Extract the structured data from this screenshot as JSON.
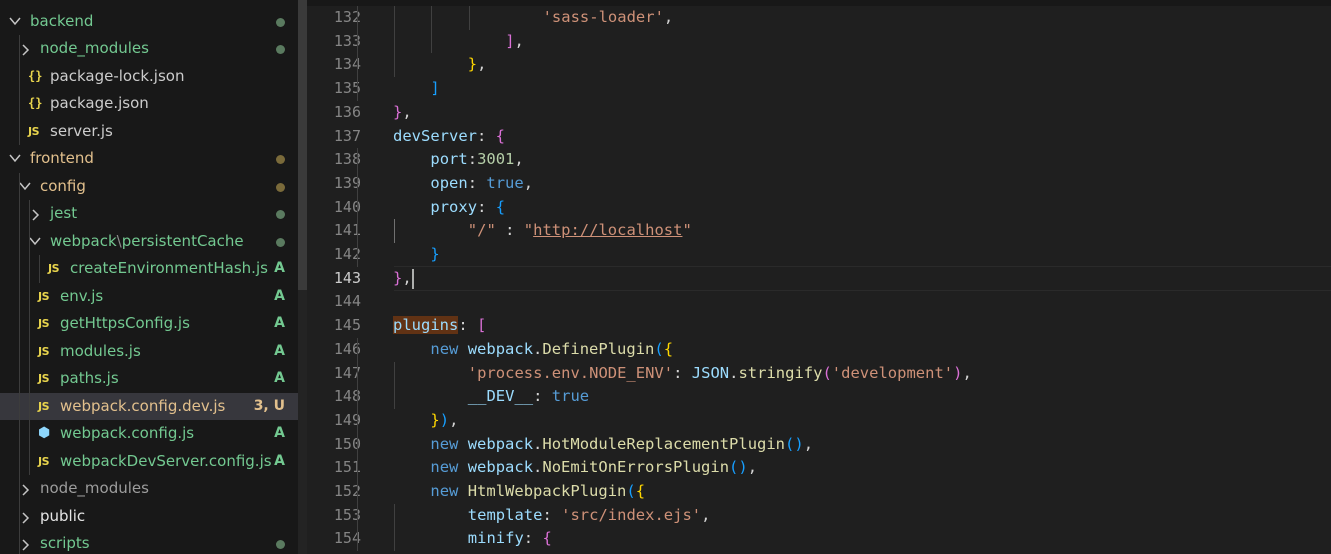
{
  "colors": {
    "folder_modified": "#d7ba7d",
    "folder_clean": "#e5e5e5",
    "added": "#73c991",
    "modified": "#e2c08d",
    "dot_green": "#5a7a5f",
    "dot_yellow": "#7a6a3a",
    "keyword": "#569cd6",
    "string": "#ce9178",
    "property": "#9cdcfe",
    "function": "#dcdcaa",
    "number": "#b5cea8",
    "bracket_gold": "#ffd700",
    "bracket_purple": "#da70d6",
    "bracket_blue": "#179fff"
  },
  "explorer": {
    "items": [
      {
        "label": "backend",
        "type": "folder",
        "expanded": true,
        "depth": 0,
        "decoration": "dot",
        "dot_color": "green",
        "label_color": "added"
      },
      {
        "label": "node_modules",
        "type": "folder",
        "expanded": false,
        "depth": 1,
        "decoration": "dot",
        "dot_color": "green",
        "label_color": "added"
      },
      {
        "label": "package-lock.json",
        "type": "json",
        "depth": 1,
        "label_color": "plain"
      },
      {
        "label": "package.json",
        "type": "json",
        "depth": 1,
        "label_color": "plain"
      },
      {
        "label": "server.js",
        "type": "js",
        "depth": 1,
        "label_color": "plain"
      },
      {
        "label": "frontend",
        "type": "folder",
        "expanded": true,
        "depth": 0,
        "decoration": "dot",
        "dot_color": "yellow",
        "label_color": "modified"
      },
      {
        "label": "config",
        "type": "folder",
        "expanded": true,
        "depth": 1,
        "decoration": "dot",
        "dot_color": "yellow",
        "label_color": "modified"
      },
      {
        "label": "jest",
        "type": "folder",
        "expanded": false,
        "depth": 2,
        "decoration": "dot",
        "dot_color": "green",
        "label_color": "added"
      },
      {
        "label": "webpack",
        "sep": "\\",
        "label2": "persistentCache",
        "type": "folder",
        "expanded": true,
        "depth": 2,
        "decoration": "dot",
        "dot_color": "green",
        "label_color": "added"
      },
      {
        "label": "createEnvironmentHash.js",
        "type": "js",
        "depth": 3,
        "status": "A",
        "label_color": "added"
      },
      {
        "label": "env.js",
        "type": "js",
        "depth": 2,
        "status": "A",
        "label_color": "added"
      },
      {
        "label": "getHttpsConfig.js",
        "type": "js",
        "depth": 2,
        "status": "A",
        "label_color": "added"
      },
      {
        "label": "modules.js",
        "type": "js",
        "depth": 2,
        "status": "A",
        "label_color": "added"
      },
      {
        "label": "paths.js",
        "type": "js",
        "depth": 2,
        "status": "A",
        "label_color": "added"
      },
      {
        "label": "webpack.config.dev.js",
        "type": "js",
        "depth": 2,
        "status": "3, U",
        "label_color": "modified",
        "selected": true
      },
      {
        "label": "webpack.config.js",
        "type": "webpack",
        "depth": 2,
        "status": "A",
        "label_color": "added"
      },
      {
        "label": "webpackDevServer.config.js",
        "type": "js",
        "depth": 2,
        "status": "A",
        "label_color": "added"
      },
      {
        "label": "node_modules",
        "type": "folder",
        "expanded": false,
        "depth": 1,
        "label_color": "dim"
      },
      {
        "label": "public",
        "type": "folder",
        "expanded": false,
        "depth": 1,
        "label_color": "clean"
      },
      {
        "label": "scripts",
        "type": "folder",
        "expanded": false,
        "depth": 1,
        "decoration": "dot",
        "dot_color": "green",
        "label_color": "added"
      }
    ]
  },
  "editor": {
    "active_line": 143,
    "find_widget": {
      "value": "plugins"
    },
    "lines": [
      {
        "n": 132,
        "indent": 5,
        "tokens": [
          [
            "'sass-loader'",
            "string"
          ],
          [
            ",",
            "plain"
          ]
        ]
      },
      {
        "n": 133,
        "indent": 4,
        "tokens": [
          [
            "]",
            "bracket_purple"
          ],
          [
            ",",
            "plain"
          ]
        ]
      },
      {
        "n": 134,
        "indent": 3,
        "tokens": [
          [
            "}",
            "bracket_gold"
          ],
          [
            ",",
            "plain"
          ]
        ]
      },
      {
        "n": 135,
        "indent": 2,
        "tokens": [
          [
            "]",
            "bracket_blue"
          ]
        ]
      },
      {
        "n": 136,
        "indent": 1,
        "tokens": [
          [
            "}",
            "bracket_purple"
          ],
          [
            ",",
            "plain"
          ]
        ]
      },
      {
        "n": 137,
        "indent": 1,
        "tokens": [
          [
            "devServer",
            "property"
          ],
          [
            ": ",
            "plain"
          ],
          [
            "{",
            "bracket_purple"
          ]
        ]
      },
      {
        "n": 138,
        "indent": 2,
        "tokens": [
          [
            "port",
            "property"
          ],
          [
            ":",
            "plain"
          ],
          [
            "3001",
            "number"
          ],
          [
            ",",
            "plain"
          ]
        ]
      },
      {
        "n": 139,
        "indent": 2,
        "tokens": [
          [
            "open",
            "property"
          ],
          [
            ": ",
            "plain"
          ],
          [
            "true",
            "keyword"
          ],
          [
            ",",
            "plain"
          ]
        ]
      },
      {
        "n": 140,
        "indent": 2,
        "tokens": [
          [
            "proxy",
            "property"
          ],
          [
            ": ",
            "plain"
          ],
          [
            "{",
            "bracket_blue"
          ]
        ]
      },
      {
        "n": 141,
        "indent": 3,
        "tokens": [
          [
            "\"/\"",
            "string"
          ],
          [
            " : ",
            "plain"
          ],
          [
            "\"",
            "string"
          ],
          [
            "http://localhost",
            "string_link"
          ],
          [
            "\"",
            "string"
          ]
        ]
      },
      {
        "n": 142,
        "indent": 2,
        "tokens": [
          [
            "}",
            "bracket_blue"
          ]
        ]
      },
      {
        "n": 143,
        "indent": 1,
        "tokens": [
          [
            "}",
            "bracket_purple"
          ],
          [
            ",",
            "plain"
          ]
        ]
      },
      {
        "n": 144,
        "indent": 0,
        "tokens": []
      },
      {
        "n": 145,
        "indent": 1,
        "tokens": [
          [
            "plugins",
            "property_hl"
          ],
          [
            ": ",
            "plain"
          ],
          [
            "[",
            "bracket_purple"
          ]
        ]
      },
      {
        "n": 146,
        "indent": 2,
        "tokens": [
          [
            "new ",
            "keyword"
          ],
          [
            "webpack",
            "property"
          ],
          [
            ".",
            "plain"
          ],
          [
            "DefinePlugin",
            "function"
          ],
          [
            "(",
            "bracket_blue"
          ],
          [
            "{",
            "bracket_gold"
          ]
        ]
      },
      {
        "n": 147,
        "indent": 3,
        "tokens": [
          [
            "'process.env.NODE_ENV'",
            "string"
          ],
          [
            ": ",
            "plain"
          ],
          [
            "JSON",
            "property"
          ],
          [
            ".",
            "plain"
          ],
          [
            "stringify",
            "function"
          ],
          [
            "(",
            "bracket_purple"
          ],
          [
            "'development'",
            "string"
          ],
          [
            ")",
            "bracket_purple"
          ],
          [
            ",",
            "plain"
          ]
        ]
      },
      {
        "n": 148,
        "indent": 3,
        "tokens": [
          [
            "__DEV__",
            "property"
          ],
          [
            ": ",
            "plain"
          ],
          [
            "true",
            "keyword"
          ]
        ]
      },
      {
        "n": 149,
        "indent": 2,
        "tokens": [
          [
            "}",
            "bracket_gold"
          ],
          [
            ")",
            "bracket_blue"
          ],
          [
            ",",
            "plain"
          ]
        ]
      },
      {
        "n": 150,
        "indent": 2,
        "tokens": [
          [
            "new ",
            "keyword"
          ],
          [
            "webpack",
            "property"
          ],
          [
            ".",
            "plain"
          ],
          [
            "HotModuleReplacementPlugin",
            "function"
          ],
          [
            "()",
            "bracket_blue"
          ],
          [
            ",",
            "plain"
          ]
        ]
      },
      {
        "n": 151,
        "indent": 2,
        "tokens": [
          [
            "new ",
            "keyword"
          ],
          [
            "webpack",
            "property"
          ],
          [
            ".",
            "plain"
          ],
          [
            "NoEmitOnErrorsPlugin",
            "function"
          ],
          [
            "()",
            "bracket_blue"
          ],
          [
            ",",
            "plain"
          ]
        ]
      },
      {
        "n": 152,
        "indent": 2,
        "tokens": [
          [
            "new ",
            "keyword"
          ],
          [
            "HtmlWebpackPlugin",
            "function"
          ],
          [
            "(",
            "bracket_blue"
          ],
          [
            "{",
            "bracket_gold"
          ]
        ]
      },
      {
        "n": 153,
        "indent": 3,
        "tokens": [
          [
            "template",
            "property"
          ],
          [
            ": ",
            "plain"
          ],
          [
            "'src/index.ejs'",
            "string"
          ],
          [
            ",",
            "plain"
          ]
        ]
      },
      {
        "n": 154,
        "indent": 3,
        "tokens": [
          [
            "minify",
            "property"
          ],
          [
            ": ",
            "plain"
          ],
          [
            "{",
            "bracket_purple"
          ]
        ]
      }
    ]
  }
}
